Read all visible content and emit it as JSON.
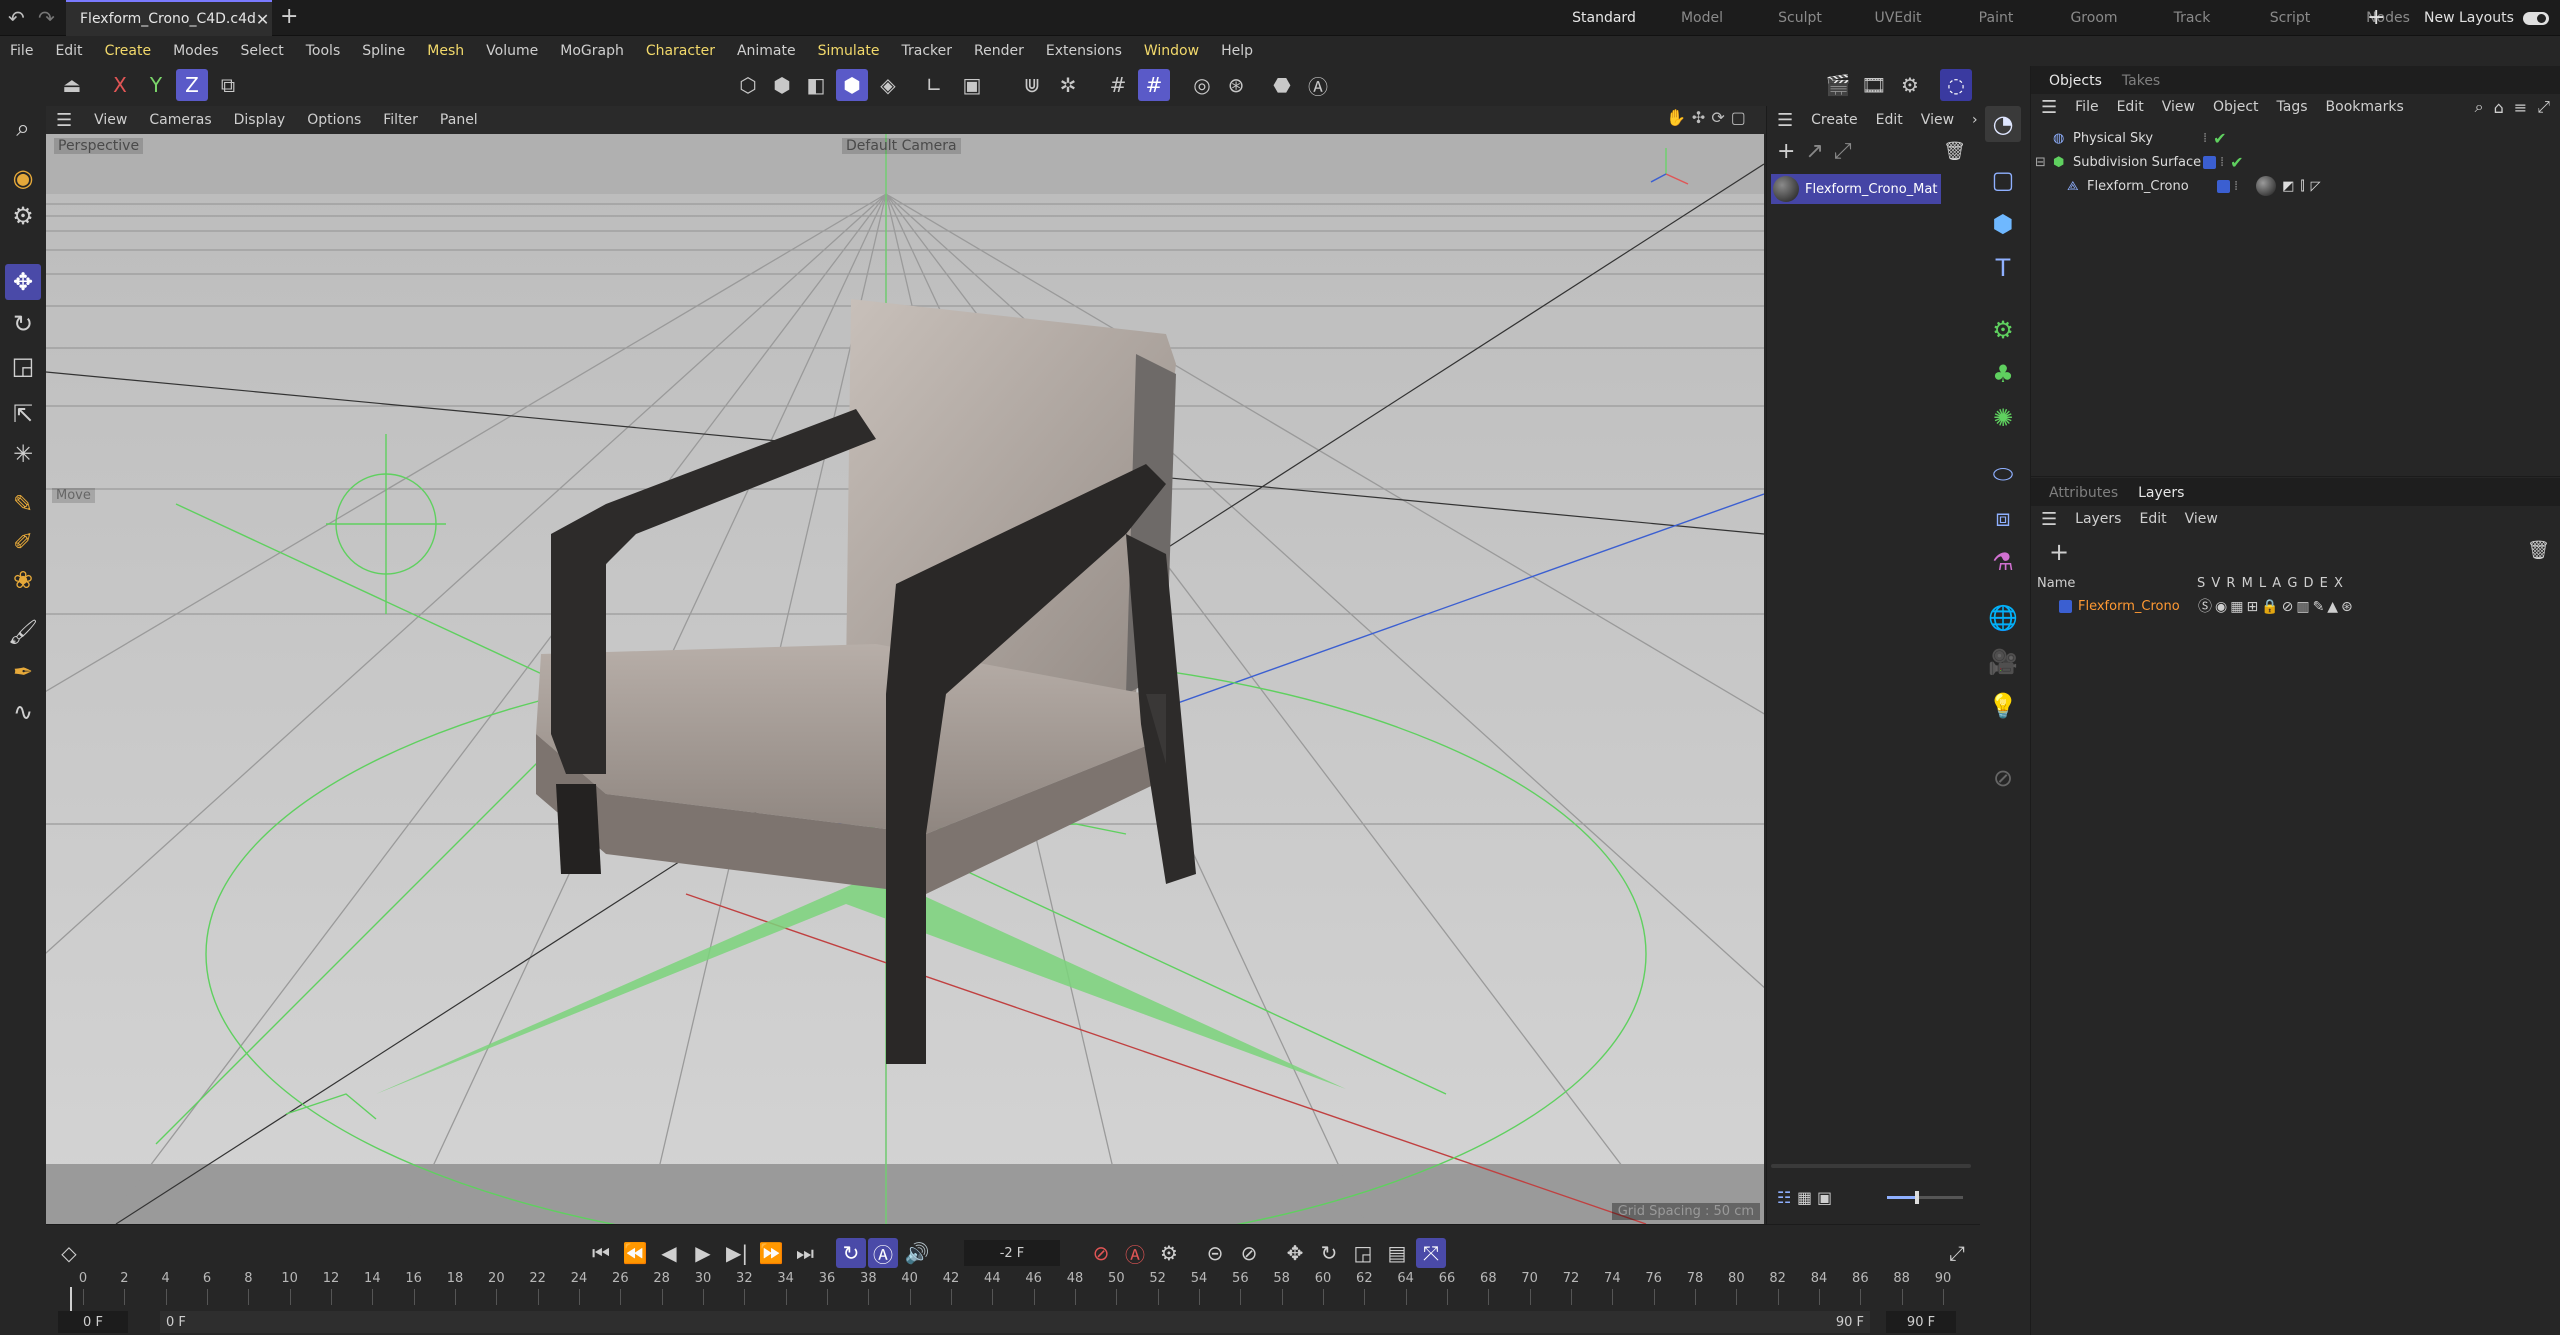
{
  "titlebar": {
    "file_tab": "Flexform_Crono_C4D.c4d",
    "close": "✕",
    "new_tab": "+",
    "layouts": [
      "Standard",
      "Model",
      "Sculpt",
      "UVEdit",
      "Paint",
      "Groom",
      "Track",
      "Script",
      "Nodes"
    ],
    "add_layout": "+",
    "new_layouts": "New Layouts"
  },
  "menubar": [
    "File",
    "Edit",
    "Create",
    "Modes",
    "Select",
    "Tools",
    "Spline",
    "Mesh",
    "Volume",
    "MoGraph",
    "Character",
    "Animate",
    "Simulate",
    "Tracker",
    "Render",
    "Extensions",
    "Window",
    "Help"
  ],
  "toolbar": {
    "x": "X",
    "y": "Y",
    "z": "Z"
  },
  "viewport": {
    "menu": [
      "View",
      "Cameras",
      "Display",
      "Options",
      "Filter",
      "Panel"
    ],
    "label": "Perspective",
    "camera": "Default Camera",
    "grid_spacing": "Grid Spacing : 50 cm",
    "move_label": "Move"
  },
  "materials": {
    "menu": [
      "Create",
      "Edit",
      "View"
    ],
    "item": "Flexform_Crono_Mat"
  },
  "objects": {
    "tabs": [
      "Objects",
      "Takes"
    ],
    "menu": [
      "File",
      "Edit",
      "View",
      "Object",
      "Tags",
      "Bookmarks"
    ],
    "items": [
      "Physical Sky",
      "Subdivision Surface",
      "Flexform_Crono"
    ]
  },
  "layers": {
    "tabs": [
      "Attributes",
      "Layers"
    ],
    "menu": [
      "Layers",
      "Edit",
      "View"
    ],
    "name_header": "Name",
    "flags": "S V R M L A G D E X",
    "items": [
      "Flexform_Crono"
    ]
  },
  "timeline": {
    "current_frame": "-2 F",
    "start": "0 F",
    "start2": "0 F",
    "end": "90 F",
    "end2": "90 F",
    "ticks": [
      "0",
      "2",
      "4",
      "6",
      "8",
      "10",
      "12",
      "14",
      "16",
      "18",
      "20",
      "22",
      "24",
      "26",
      "28",
      "30",
      "32",
      "34",
      "36",
      "38",
      "40",
      "42",
      "44",
      "46",
      "48",
      "50",
      "52",
      "54",
      "56",
      "58",
      "60",
      "62",
      "64",
      "66",
      "68",
      "70",
      "72",
      "74",
      "76",
      "78",
      "80",
      "82",
      "84",
      "86",
      "88",
      "90"
    ]
  },
  "colors": {
    "accent": "#4a4aa8",
    "menu_highlight": "#f2d96b",
    "check": "#5fd05f",
    "layer_color": "#3b5fd1",
    "layer_name": "#ff9933"
  }
}
